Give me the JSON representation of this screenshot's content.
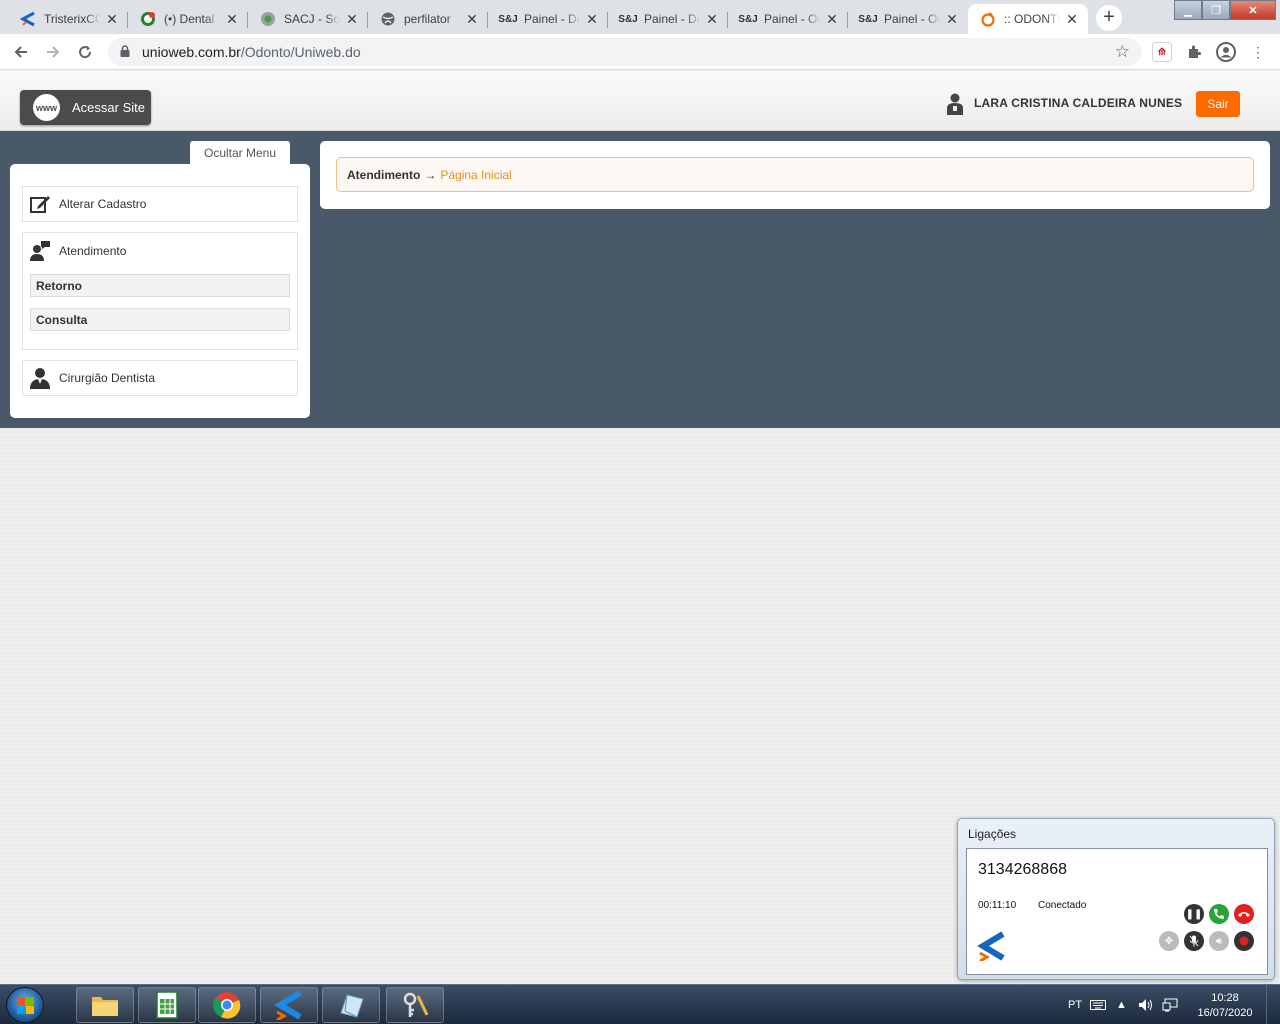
{
  "browser": {
    "tabs": [
      {
        "title": "TristerixCC",
        "icon": "tristerix-icon",
        "active": false
      },
      {
        "title": "(•) Dental",
        "icon": "whatsapp-icon",
        "active": false
      },
      {
        "title": "SACJ - Sof",
        "icon": "sacj-icon",
        "active": false
      },
      {
        "title": "perfilator",
        "icon": "globe-icon",
        "active": false
      },
      {
        "title": "Painel - De",
        "icon": "painel-icon",
        "active": false
      },
      {
        "title": "Painel - De",
        "icon": "painel-icon",
        "active": false
      },
      {
        "title": "Painel - Oc",
        "icon": "painel-icon",
        "active": false
      },
      {
        "title": "Painel - Oc",
        "icon": "painel-icon",
        "active": false
      },
      {
        "title": ":: ODONTO",
        "icon": "odonto-icon",
        "active": true
      }
    ],
    "new_tab_label": "+",
    "url_host": "unioweb.com.br",
    "url_path": "/Odonto/Uniweb.do"
  },
  "header": {
    "site_button_label": "Acessar Site",
    "site_icon_text": "www",
    "user_name": "LARA CRISTINA CALDEIRA NUNES",
    "logout_label": "Sair"
  },
  "sidebar": {
    "toggle_label": "Ocultar Menu",
    "items": [
      {
        "label": "Alterar Cadastro",
        "icon": "edit-icon"
      },
      {
        "label": "Atendimento",
        "icon": "support-user-icon",
        "children": [
          "Retorno",
          "Consulta"
        ]
      },
      {
        "label": "Cirurgião Dentista",
        "icon": "doctor-icon"
      }
    ]
  },
  "breadcrumb": {
    "section": "Atendimento",
    "separator": "→",
    "page": "Página Inicial"
  },
  "softphone": {
    "title": "Ligações",
    "number": "3134268868",
    "timer": "00:11:10",
    "status": "Conectado"
  },
  "taskbar": {
    "language": "PT",
    "time": "10:28",
    "date": "16/07/2020"
  },
  "colors": {
    "accent_orange": "#ff6a00",
    "band_bg": "#4a5968",
    "breadcrumb_link": "#e8901c"
  }
}
